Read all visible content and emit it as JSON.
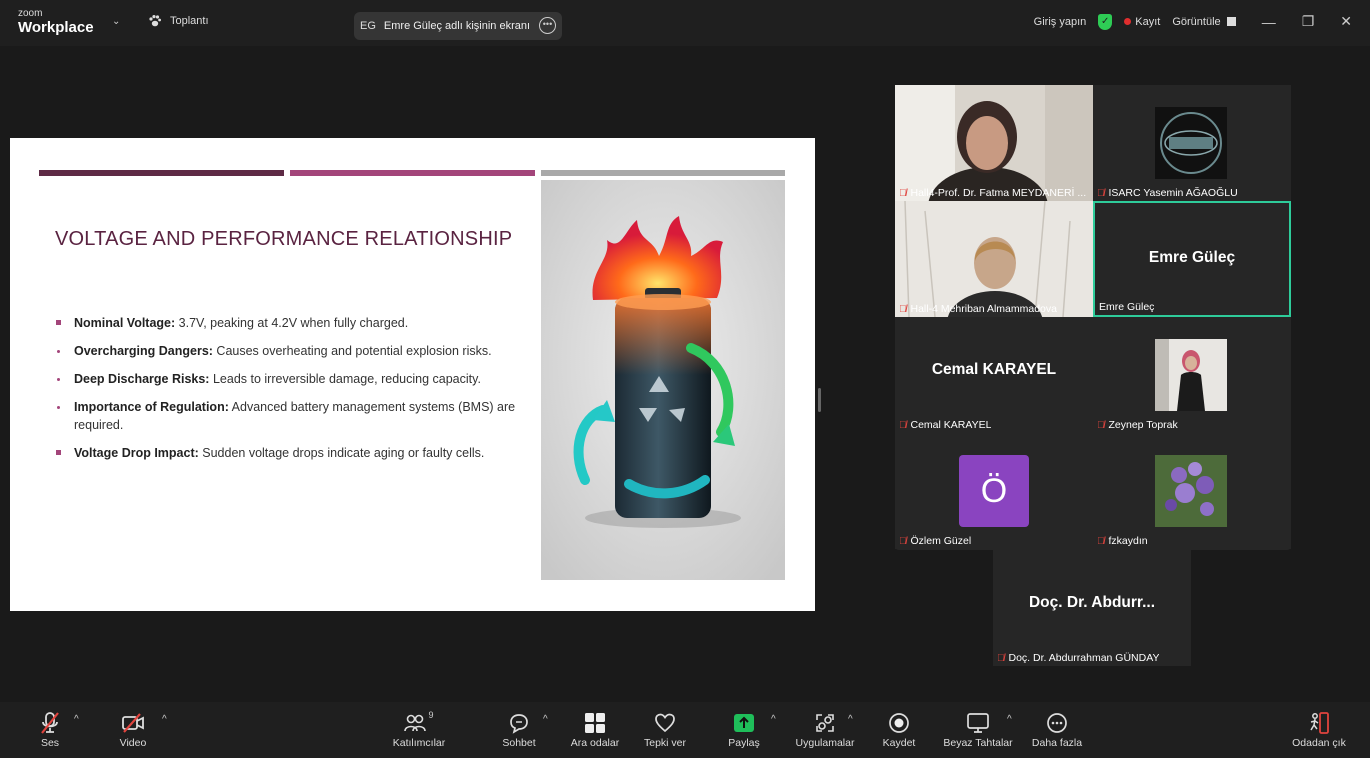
{
  "titlebar": {
    "brand_small": "zoom",
    "brand_large": "Workplace",
    "meeting_label": "Toplantı",
    "screen_initials": "EG",
    "screen_label": "Emre Güleç adlı kişinin ekranı",
    "signin_label": "Giriş yapın",
    "record_label": "Kayıt",
    "view_label": "Görüntüle"
  },
  "slide": {
    "title": "VOLTAGE AND PERFORMANCE RELATIONSHIP",
    "bullets": [
      {
        "bold": "Nominal Voltage:",
        "text": " 3.7V, peaking at 4.2V when fully charged."
      },
      {
        "bold": "Overcharging Dangers:",
        "text": " Causes overheating and potential explosion risks."
      },
      {
        "bold": "Deep Discharge Risks:",
        "text": " Leads to irreversible damage, reducing capacity."
      },
      {
        "bold": "Importance of Regulation:",
        "text": " Advanced battery management systems (BMS) are required."
      },
      {
        "bold": "Voltage Drop Impact:",
        "text": " Sudden voltage drops indicate aging or faulty cells."
      }
    ],
    "colors": {
      "title": "#5a2341",
      "bar1": "#5e2a45",
      "bar2": "#a3457a",
      "bar3": "#a9a9a9"
    }
  },
  "participants": [
    {
      "label": "Hall4-Prof. Dr. Fatma MEYDANERİ ...",
      "type": "video"
    },
    {
      "label": "ISARC Yasemin AĞAOĞLU",
      "type": "logo"
    },
    {
      "label": "Hall-4 Mehriban Almammadova",
      "type": "video"
    },
    {
      "label": "Emre Güleç",
      "big_name": "Emre Güleç",
      "type": "name",
      "active": true
    },
    {
      "label": "Cemal KARAYEL",
      "big_name": "Cemal KARAYEL",
      "type": "name"
    },
    {
      "label": "Zeynep Toprak",
      "type": "photo"
    },
    {
      "label": "Özlem Güzel",
      "avatar_letter": "Ö",
      "type": "avatar"
    },
    {
      "label": "fzkaydın",
      "type": "flower"
    },
    {
      "label": "Doç. Dr. Abdurrahman GÜNDAY",
      "big_name": "Doç. Dr. Abdurr...",
      "type": "name"
    }
  ],
  "toolbar": {
    "audio": "Ses",
    "video": "Video",
    "participants": "Katılımcılar",
    "participants_count": "9",
    "chat": "Sohbet",
    "breakout": "Ara odalar",
    "react": "Tepki ver",
    "share": "Paylaş",
    "apps": "Uygulamalar",
    "record": "Kaydet",
    "whiteboard": "Beyaz Tahtalar",
    "more": "Daha fazla",
    "leave": "Odadan çık"
  }
}
